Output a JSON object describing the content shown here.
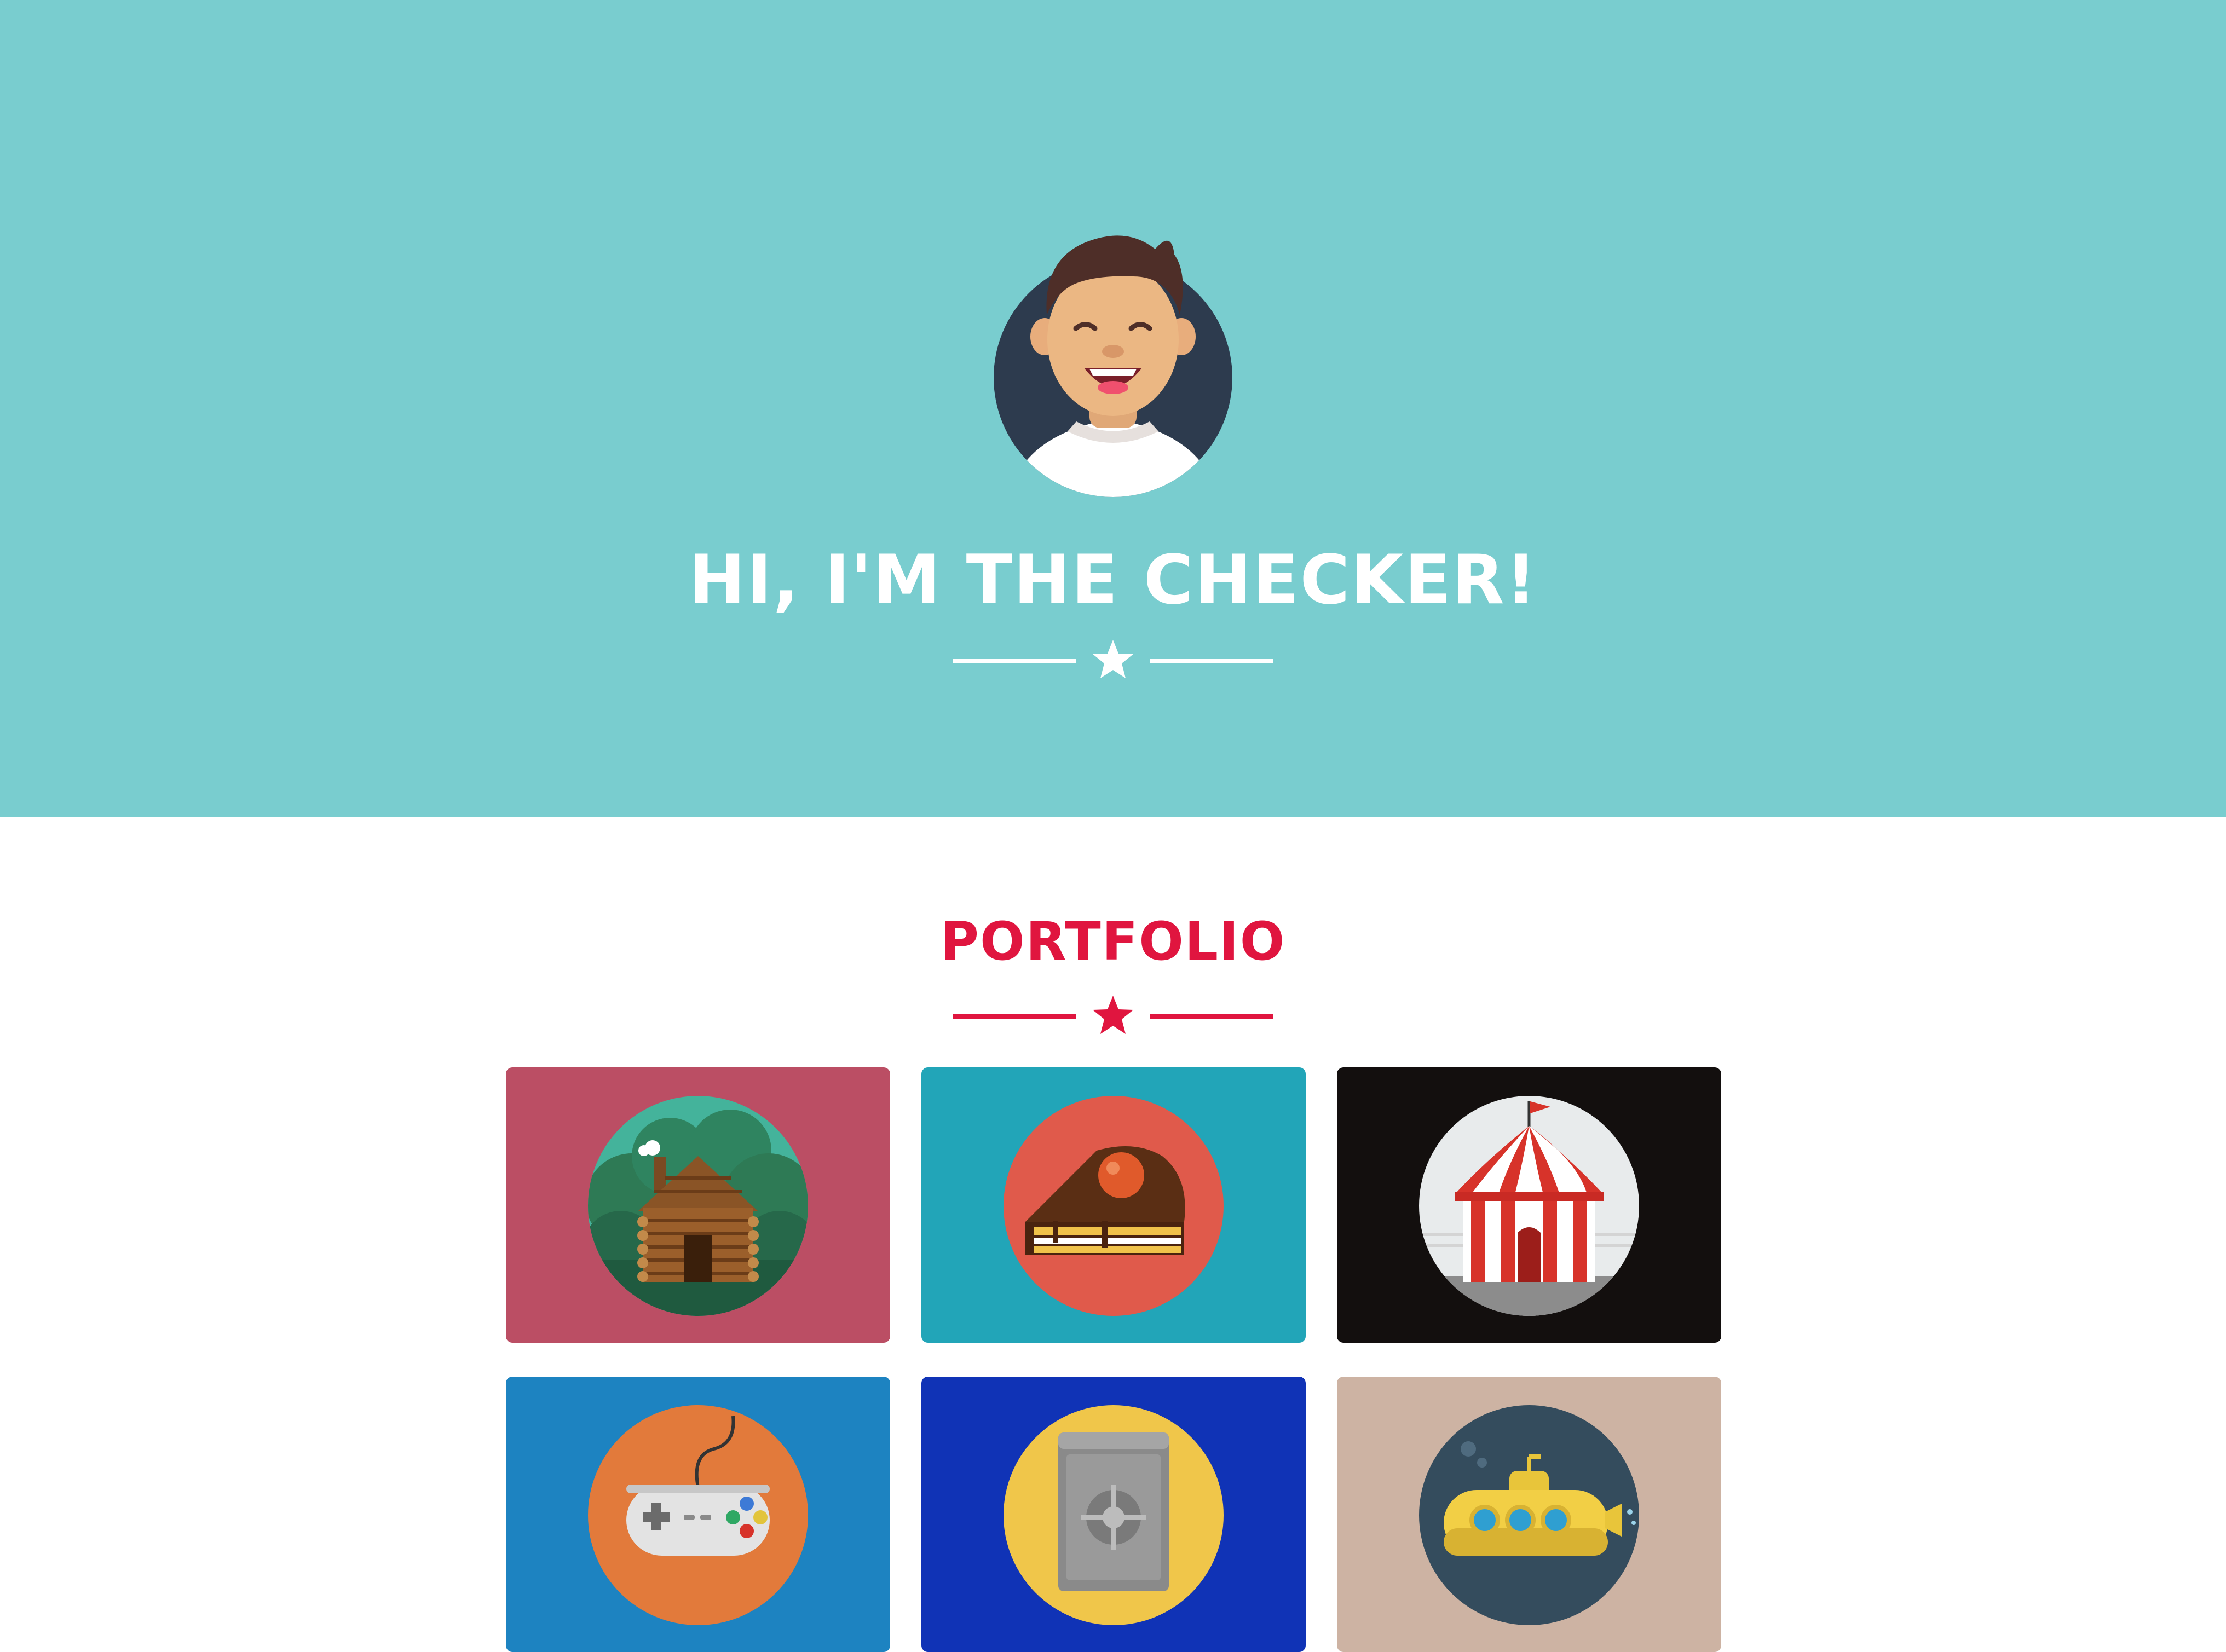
{
  "hero": {
    "title": "HI, I'M THE CHECKER!",
    "background": "#79cdcf",
    "avatar_icon": "smiling-man-avatar"
  },
  "portfolio": {
    "title": "PORTFOLIO",
    "accent": "#e0153f",
    "items": [
      {
        "icon": "log-cabin-icon",
        "background": "#bb4e64"
      },
      {
        "icon": "cake-slice-icon",
        "background": "#22a5b8"
      },
      {
        "icon": "circus-tent-icon",
        "background": "#130f0e"
      },
      {
        "icon": "game-controller-icon",
        "background": "#1d83c1"
      },
      {
        "icon": "safe-icon",
        "background": "#1033b6"
      },
      {
        "icon": "submarine-icon",
        "background": "#cdb3a3"
      }
    ]
  }
}
